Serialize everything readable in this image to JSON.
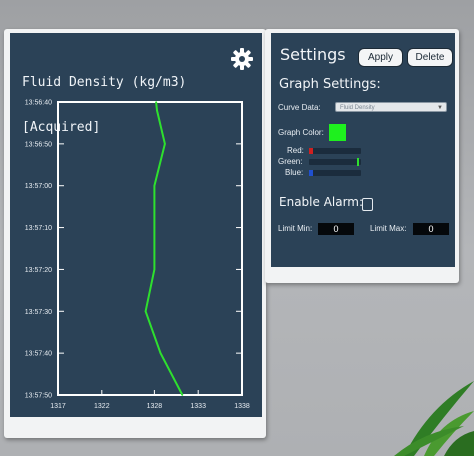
{
  "chart_panel": {
    "title_line1": "Fluid Density (kg/m3)",
    "title_line2": "[Acquired]",
    "icon": "gear-icon"
  },
  "chart_data": {
    "type": "line",
    "title": "Fluid Density (kg/m3) [Acquired]",
    "orientation": "vertical-time",
    "y_ticks": [
      "13:56:40",
      "13:56:50",
      "13:57:00",
      "13:57:10",
      "13:57:20",
      "13:57:30",
      "13:57:40",
      "13:57:50"
    ],
    "x_ticks": [
      "1317",
      "1322",
      "1328",
      "1333",
      "1338"
    ],
    "xlim": [
      1317,
      1338
    ],
    "series": [
      {
        "color": "#2ee02e",
        "points": [
          {
            "time": "13:56:40",
            "value": 1328.2
          },
          {
            "time": "13:56:42",
            "value": 1328.3
          },
          {
            "time": "13:56:50",
            "value": 1329.2
          },
          {
            "time": "13:57:00",
            "value": 1328.0
          },
          {
            "time": "13:57:10",
            "value": 1328.0
          },
          {
            "time": "13:57:20",
            "value": 1328.0
          },
          {
            "time": "13:57:30",
            "value": 1327.0
          },
          {
            "time": "13:57:40",
            "value": 1328.7
          },
          {
            "time": "13:57:50",
            "value": 1331.2
          }
        ]
      }
    ],
    "grid": false
  },
  "settings": {
    "title": "Settings",
    "apply_label": "Apply",
    "delete_label": "Delete",
    "graph_settings_title": "Graph Settings:",
    "curve_data_label": "Curve Data:",
    "curve_data_value": "Fluid Density",
    "graph_color_label": "Graph Color:",
    "graph_color": "#1ef01e",
    "red_label": "Red:",
    "green_label": "Green:",
    "blue_label": "Blue:",
    "red_value": 0.07,
    "green_value": 0.97,
    "blue_value": 0.07,
    "enable_alarm_label": "Enable Alarm:",
    "enable_alarm_checked": false,
    "limit_min_label": "Limit Min:",
    "limit_min_value": "0",
    "limit_max_label": "Limit Max:",
    "limit_max_value": "0"
  },
  "colors": {
    "panel_bg": "#2b4257",
    "plot_bg": "#2b4257",
    "axis": "#ffffff",
    "line": "#2ee02e"
  }
}
